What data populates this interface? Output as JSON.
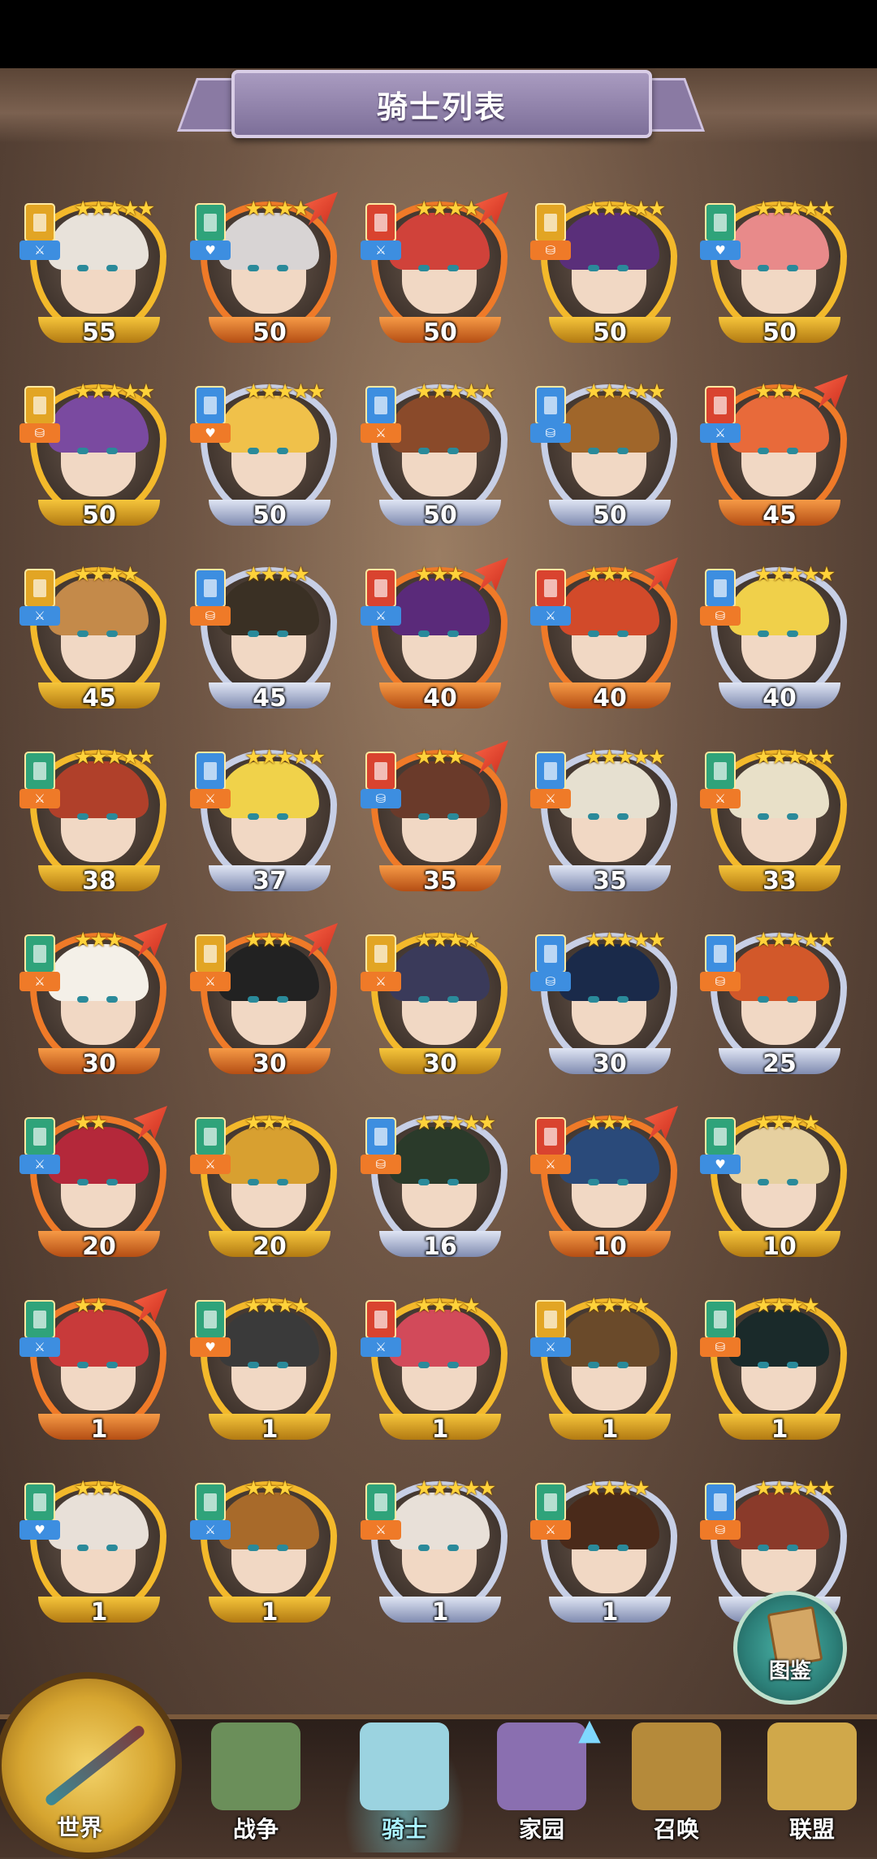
{
  "header": {
    "title": "骑士列表"
  },
  "knights": [
    {
      "level": "55",
      "stars": 5,
      "frame": "gold",
      "class_color": "#e2a524",
      "role_color": "#3d8ee0",
      "role_glyph": "⚔",
      "hair": "#e8e2da",
      "upgrade": false
    },
    {
      "level": "50",
      "stars": 4,
      "frame": "orange",
      "class_color": "#2fa37a",
      "role_color": "#3d8ee0",
      "role_glyph": "♥",
      "hair": "#d8d4d4",
      "upgrade": true
    },
    {
      "level": "50",
      "stars": 4,
      "frame": "orange",
      "class_color": "#d9432f",
      "role_color": "#3d8ee0",
      "role_glyph": "⚔",
      "hair": "#d0423a",
      "upgrade": true
    },
    {
      "level": "50",
      "stars": 5,
      "frame": "gold",
      "class_color": "#e2a524",
      "role_color": "#ef7a28",
      "role_glyph": "⛁",
      "hair": "#5a2f7a",
      "upgrade": false
    },
    {
      "level": "50",
      "stars": 5,
      "frame": "gold",
      "class_color": "#2fa37a",
      "role_color": "#3d8ee0",
      "role_glyph": "♥",
      "hair": "#e88a8a",
      "upgrade": false
    },
    {
      "level": "50",
      "stars": 5,
      "frame": "gold",
      "class_color": "#e2a524",
      "role_color": "#ef7a28",
      "role_glyph": "⛁",
      "hair": "#7a4aa0",
      "upgrade": false
    },
    {
      "level": "50",
      "stars": 5,
      "frame": "silver",
      "class_color": "#3d8ee0",
      "role_color": "#ef7a28",
      "role_glyph": "♥",
      "hair": "#f0c14a",
      "upgrade": false
    },
    {
      "level": "50",
      "stars": 5,
      "frame": "silver",
      "class_color": "#3d8ee0",
      "role_color": "#ef7a28",
      "role_glyph": "⚔",
      "hair": "#8a4a2a",
      "upgrade": false
    },
    {
      "level": "50",
      "stars": 5,
      "frame": "silver",
      "class_color": "#3d8ee0",
      "role_color": "#3d8ee0",
      "role_glyph": "⛁",
      "hair": "#a0662a",
      "upgrade": false
    },
    {
      "level": "45",
      "stars": 3,
      "frame": "orange",
      "class_color": "#d9432f",
      "role_color": "#3d8ee0",
      "role_glyph": "⚔",
      "hair": "#e86a3a",
      "upgrade": true
    },
    {
      "level": "45",
      "stars": 4,
      "frame": "gold",
      "class_color": "#e2a524",
      "role_color": "#3d8ee0",
      "role_glyph": "⚔",
      "hair": "#c48a4a",
      "upgrade": false
    },
    {
      "level": "45",
      "stars": 4,
      "frame": "silver",
      "class_color": "#3d8ee0",
      "role_color": "#ef7a28",
      "role_glyph": "⛁",
      "hair": "#3a3024",
      "upgrade": false
    },
    {
      "level": "40",
      "stars": 3,
      "frame": "orange",
      "class_color": "#d9432f",
      "role_color": "#3d8ee0",
      "role_glyph": "⚔",
      "hair": "#5a2a7a",
      "upgrade": true
    },
    {
      "level": "40",
      "stars": 3,
      "frame": "orange",
      "class_color": "#d9432f",
      "role_color": "#3d8ee0",
      "role_glyph": "⚔",
      "hair": "#d24a2a",
      "upgrade": true
    },
    {
      "level": "40",
      "stars": 5,
      "frame": "silver",
      "class_color": "#3d8ee0",
      "role_color": "#ef7a28",
      "role_glyph": "⛁",
      "hair": "#f0d04a",
      "upgrade": false
    },
    {
      "level": "38",
      "stars": 5,
      "frame": "gold",
      "class_color": "#2fa37a",
      "role_color": "#ef7a28",
      "role_glyph": "⚔",
      "hair": "#b0402a",
      "upgrade": false
    },
    {
      "level": "37",
      "stars": 5,
      "frame": "silver",
      "class_color": "#3d8ee0",
      "role_color": "#ef7a28",
      "role_glyph": "⚔",
      "hair": "#f0d24a",
      "upgrade": false
    },
    {
      "level": "35",
      "stars": 3,
      "frame": "orange",
      "class_color": "#d9432f",
      "role_color": "#3d8ee0",
      "role_glyph": "⛁",
      "hair": "#6a3a2a",
      "upgrade": true
    },
    {
      "level": "35",
      "stars": 5,
      "frame": "silver",
      "class_color": "#3d8ee0",
      "role_color": "#ef7a28",
      "role_glyph": "⚔",
      "hair": "#e6e0d0",
      "upgrade": false
    },
    {
      "level": "33",
      "stars": 5,
      "frame": "gold",
      "class_color": "#2fa37a",
      "role_color": "#ef7a28",
      "role_glyph": "⚔",
      "hair": "#e8e0c8",
      "upgrade": false
    },
    {
      "level": "30",
      "stars": 3,
      "frame": "orange",
      "class_color": "#2fa37a",
      "role_color": "#ef7a28",
      "role_glyph": "⚔",
      "hair": "#f4f0e8",
      "upgrade": true
    },
    {
      "level": "30",
      "stars": 3,
      "frame": "orange",
      "class_color": "#e2a524",
      "role_color": "#ef7a28",
      "role_glyph": "⚔",
      "hair": "#222222",
      "upgrade": true
    },
    {
      "level": "30",
      "stars": 4,
      "frame": "gold",
      "class_color": "#e2a524",
      "role_color": "#ef7a28",
      "role_glyph": "⚔",
      "hair": "#3a3a5a",
      "upgrade": false
    },
    {
      "level": "30",
      "stars": 5,
      "frame": "silver",
      "class_color": "#3d8ee0",
      "role_color": "#3d8ee0",
      "role_glyph": "⛁",
      "hair": "#1a2a4a",
      "upgrade": false
    },
    {
      "level": "25",
      "stars": 5,
      "frame": "silver",
      "class_color": "#3d8ee0",
      "role_color": "#ef7a28",
      "role_glyph": "⛁",
      "hair": "#d2582a",
      "upgrade": false
    },
    {
      "level": "20",
      "stars": 2,
      "frame": "orange",
      "class_color": "#2fa37a",
      "role_color": "#3d8ee0",
      "role_glyph": "⚔",
      "hair": "#b4283a",
      "upgrade": true
    },
    {
      "level": "20",
      "stars": 3,
      "frame": "gold",
      "class_color": "#2fa37a",
      "role_color": "#ef7a28",
      "role_glyph": "⚔",
      "hair": "#d8a030",
      "upgrade": false
    },
    {
      "level": "16",
      "stars": 5,
      "frame": "silver",
      "class_color": "#3d8ee0",
      "role_color": "#ef7a28",
      "role_glyph": "⛁",
      "hair": "#2a3a2a",
      "upgrade": false
    },
    {
      "level": "10",
      "stars": 3,
      "frame": "orange",
      "class_color": "#d9432f",
      "role_color": "#ef7a28",
      "role_glyph": "⚔",
      "hair": "#2a4a7a",
      "upgrade": true
    },
    {
      "level": "10",
      "stars": 4,
      "frame": "gold",
      "class_color": "#2fa37a",
      "role_color": "#3d8ee0",
      "role_glyph": "♥",
      "hair": "#e6d0a0",
      "upgrade": false
    },
    {
      "level": "1",
      "stars": 2,
      "frame": "orange",
      "class_color": "#2fa37a",
      "role_color": "#3d8ee0",
      "role_glyph": "⚔",
      "hair": "#c83a3a",
      "upgrade": true
    },
    {
      "level": "1",
      "stars": 4,
      "frame": "gold",
      "class_color": "#2fa37a",
      "role_color": "#ef7a28",
      "role_glyph": "♥",
      "hair": "#3a3a3a",
      "upgrade": false
    },
    {
      "level": "1",
      "stars": 4,
      "frame": "gold",
      "class_color": "#d9432f",
      "role_color": "#3d8ee0",
      "role_glyph": "⚔",
      "hair": "#d24a5a",
      "upgrade": false
    },
    {
      "level": "1",
      "stars": 4,
      "frame": "gold",
      "class_color": "#e2a524",
      "role_color": "#3d8ee0",
      "role_glyph": "⚔",
      "hair": "#6a4a2a",
      "upgrade": false
    },
    {
      "level": "1",
      "stars": 4,
      "frame": "gold",
      "class_color": "#2fa37a",
      "role_color": "#ef7a28",
      "role_glyph": "⛁",
      "hair": "#1a2a2a",
      "upgrade": false
    },
    {
      "level": "1",
      "stars": 3,
      "frame": "gold",
      "class_color": "#2fa37a",
      "role_color": "#3d8ee0",
      "role_glyph": "♥",
      "hair": "#e8e0d8",
      "upgrade": false
    },
    {
      "level": "1",
      "stars": 3,
      "frame": "gold",
      "class_color": "#2fa37a",
      "role_color": "#3d8ee0",
      "role_glyph": "⚔",
      "hair": "#a86a2a",
      "upgrade": false
    },
    {
      "level": "1",
      "stars": 5,
      "frame": "silver",
      "class_color": "#2fa37a",
      "role_color": "#ef7a28",
      "role_glyph": "⚔",
      "hair": "#e8e0d8",
      "upgrade": false
    },
    {
      "level": "1",
      "stars": 4,
      "frame": "silver",
      "class_color": "#2fa37a",
      "role_color": "#ef7a28",
      "role_glyph": "⚔",
      "hair": "#4a2a1a",
      "upgrade": false
    },
    {
      "level": "1",
      "stars": 5,
      "frame": "silver",
      "class_color": "#3d8ee0",
      "role_color": "#ef7a28",
      "role_glyph": "⛁",
      "hair": "#8a3a2a",
      "upgrade": false
    }
  ],
  "codex": {
    "label": "图鉴",
    "icon": "book-icon"
  },
  "nav": {
    "world": "世界",
    "items": [
      {
        "key": "war",
        "label": "战争",
        "icon": "map-icon",
        "icon_color": "#6b8f5a"
      },
      {
        "key": "knight",
        "label": "骑士",
        "icon": "knight-icon",
        "icon_color": "#9bd3e0",
        "active": true
      },
      {
        "key": "home",
        "label": "家园",
        "icon": "house-icon",
        "icon_color": "#8a6fb0"
      },
      {
        "key": "summon",
        "label": "召唤",
        "icon": "train-icon",
        "icon_color": "#b58a3a"
      },
      {
        "key": "alliance",
        "label": "联盟",
        "icon": "throne-icon",
        "icon_color": "#d0a84a"
      }
    ]
  }
}
